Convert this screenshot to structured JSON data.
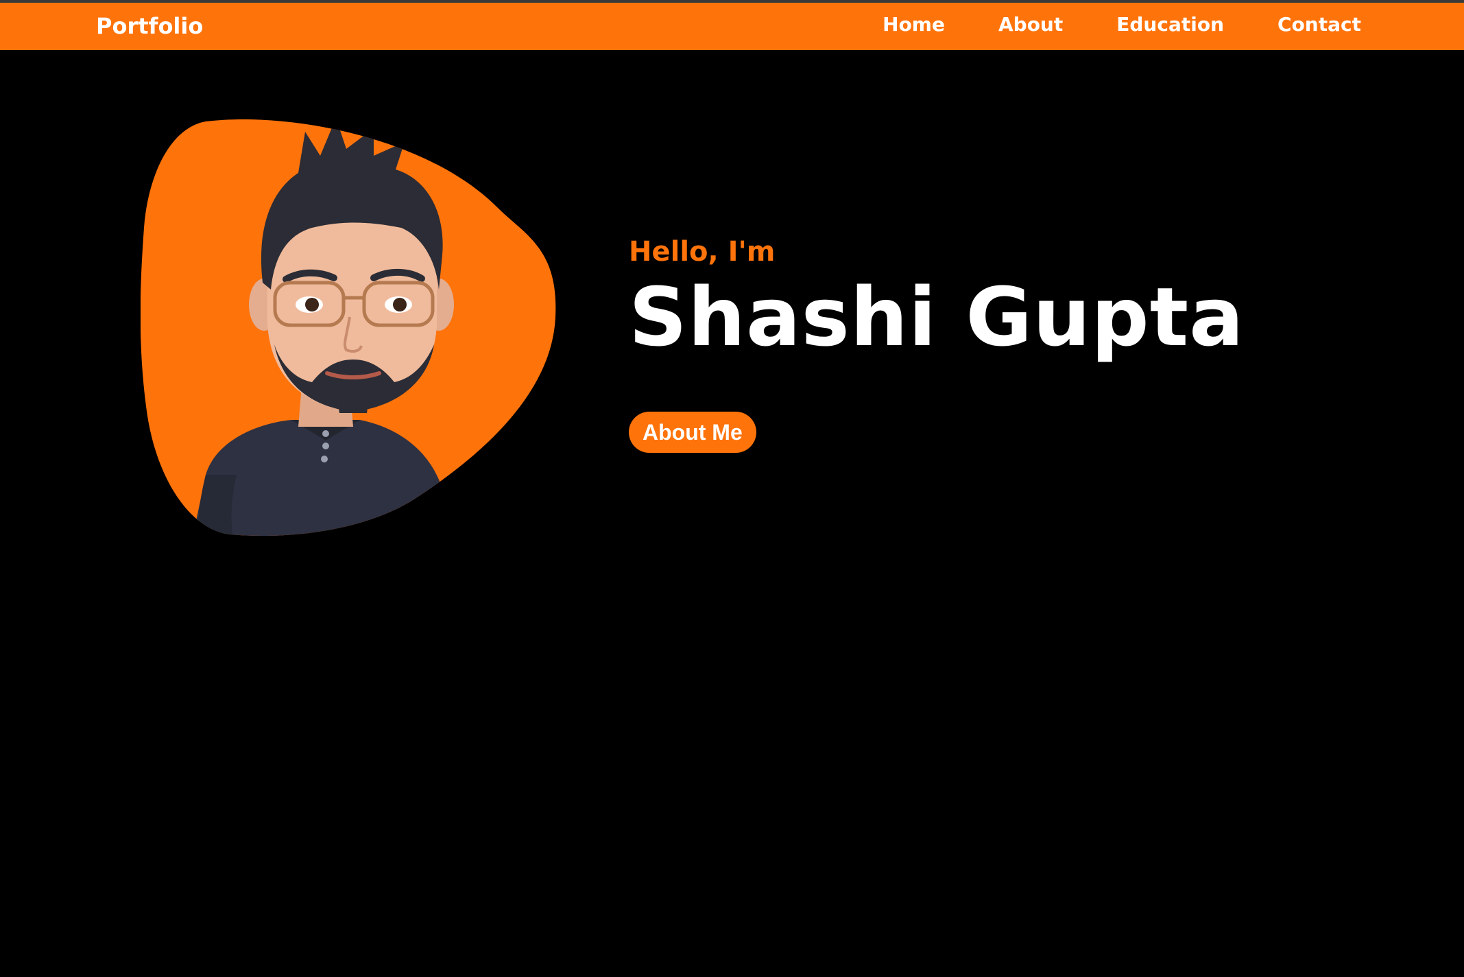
{
  "nav": {
    "brand": "Portfolio",
    "links": [
      {
        "label": "Home"
      },
      {
        "label": "About"
      },
      {
        "label": "Education"
      },
      {
        "label": "Contact"
      }
    ]
  },
  "hero": {
    "greeting": "Hello, I'm",
    "name": "Shashi Gupta",
    "cta_label": "About Me",
    "avatar_icon": "memoji-avatar"
  },
  "colors": {
    "accent": "#ff730b",
    "background": "#000000",
    "text": "#ffffff"
  }
}
